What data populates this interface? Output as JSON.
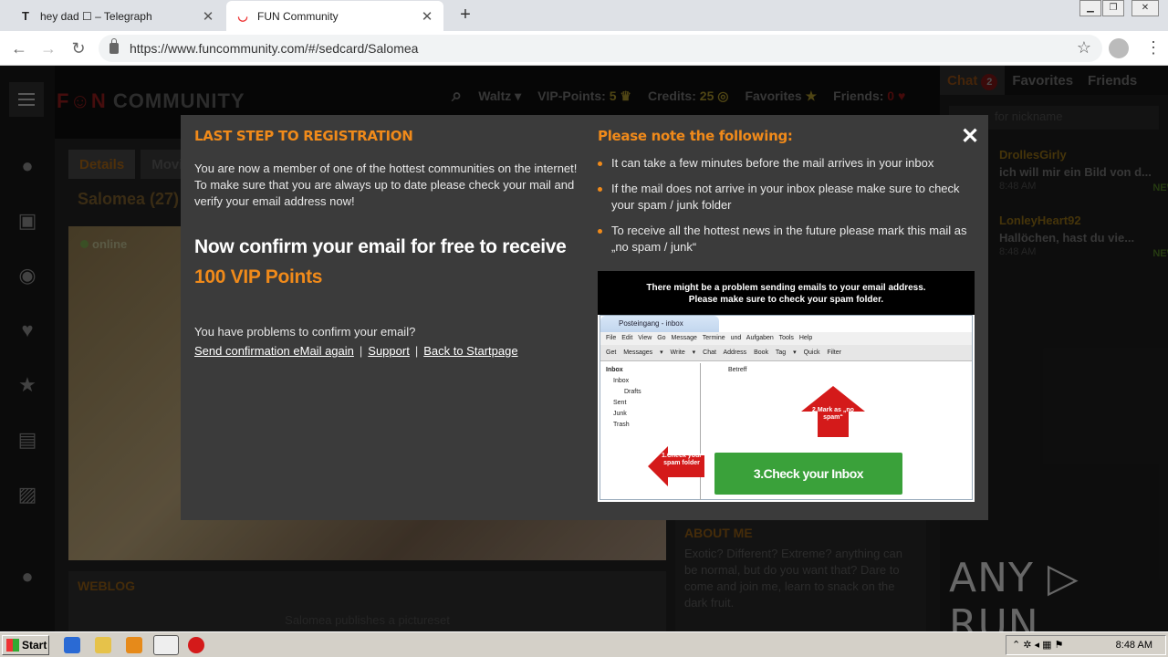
{
  "browser": {
    "tabs": [
      {
        "favicon": "T",
        "title": "hey dad ☐ – Telegraph"
      },
      {
        "favicon": "smile-icon",
        "title": "FUN Community"
      }
    ],
    "url": "https://www.funcommunity.com/#/sedcard/Salomea"
  },
  "site": {
    "logo_fun": "F☺N",
    "logo_community": "COMMUNITY",
    "nav": {
      "user": "Waltz",
      "vip_label": "VIP-Points:",
      "vip_value": "5",
      "credits_label": "Credits:",
      "credits_value": "25",
      "favorites": "Favorites",
      "friends_label": "Friends:",
      "friends_value": "0"
    },
    "profile": {
      "tab_details": "Details",
      "tab_movies": "Movies",
      "name": "Salomea (27)",
      "status": "online"
    },
    "weblog": {
      "heading": "WEBLOG",
      "text": "Salomea publishes a pictureset"
    },
    "about": {
      "heading": "ABOUT ME",
      "text": "Exotic? Different? Extreme? anything can be normal, but do you want that? Dare to come and join me, learn to snack on the dark fruit."
    },
    "chat": {
      "tab_chat": "Chat",
      "chat_badge": "2",
      "tab_favorites": "Favorites",
      "tab_friends": "Friends",
      "search_placeholder": "for nickname",
      "items": [
        {
          "name": "DrollesGirly",
          "message": "ich will mir ein Bild von d...",
          "time": "8:48 AM",
          "badge": "NEW"
        },
        {
          "name": "LonleyHeart92",
          "message": "Hallöchen, hast du vie...",
          "time": "8:48 AM",
          "badge": "NEW"
        }
      ]
    }
  },
  "modal": {
    "left_heading": "LAST STEP TO REGISTRATION",
    "intro": "You are now a member of one of the hottest communities on the internet! To make sure that you are always up to date please check your mail and verify your email address now!",
    "big_line": "Now confirm your email for free to receive",
    "big_highlight": "100 VIP Points",
    "question": "You have problems to confirm your email?",
    "link_resend": "Send confirmation eMail again",
    "link_support": "Support",
    "link_start": "Back to Startpage",
    "sep": "|",
    "right_heading": "Please note the following:",
    "notes": [
      "It can take a few minutes before the mail arrives in your inbox",
      "If the mail does not arrive in your inbox please make sure to check your spam / junk folder",
      "To receive all the hottest news in the future please mark this mail as „no spam / junk“"
    ],
    "close": "✕",
    "illustration": {
      "banner_line1": "There might be a problem sending emails to your email address.",
      "banner_line2": "Please make sure to check your spam folder.",
      "window_title": "Posteingang - inbox",
      "menu": "File Edit View Go Message Termine und Aufgaben Tools Help",
      "toolbar": "Get Messages ▾ Write ▾ Chat Address Book Tag ▾ Quick Filter",
      "folders": [
        "Inbox",
        "Inbox",
        "Drafts",
        "Sent",
        "Junk",
        "Trash"
      ],
      "column": "Betreff",
      "step1": "1.Check your spam folder",
      "step2": "2.Mark as „no spam“",
      "step3": "3.Check your Inbox"
    }
  },
  "watermark": "ANY ▷ RUN",
  "taskbar": {
    "start": "Start",
    "clock": "8:48 AM"
  }
}
